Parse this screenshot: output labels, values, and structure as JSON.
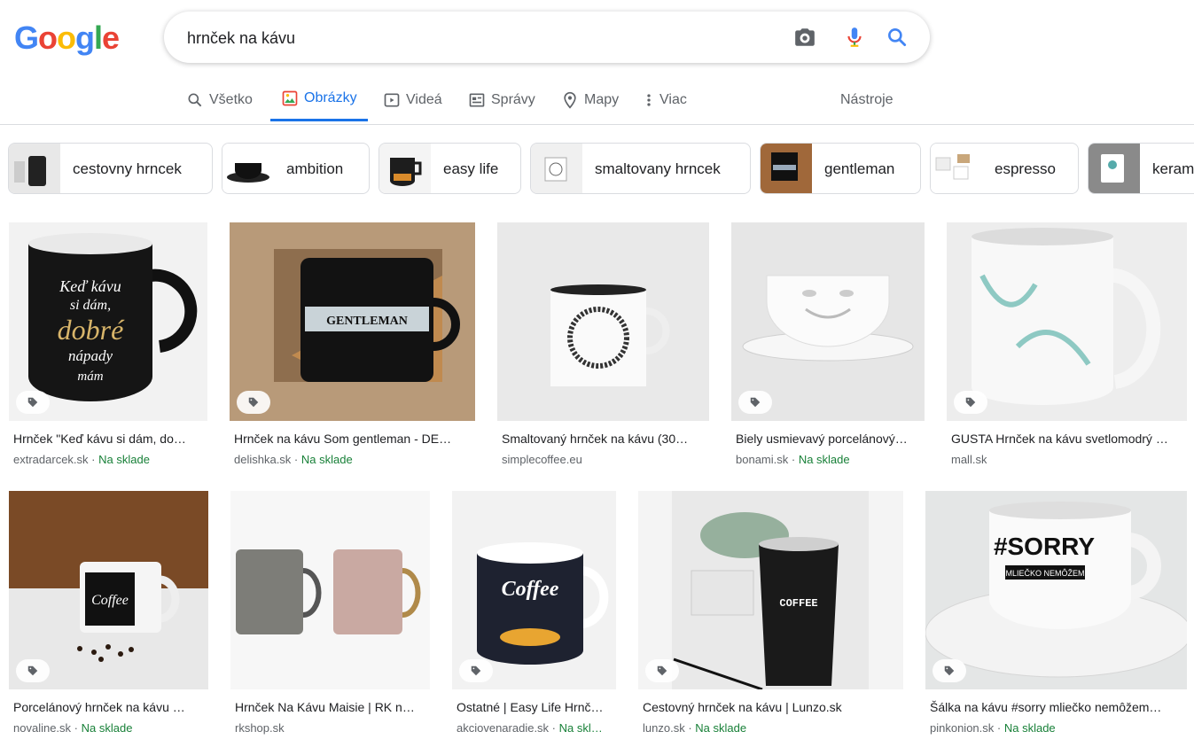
{
  "logo": {
    "letters": [
      "G",
      "o",
      "o",
      "g",
      "l",
      "e"
    ],
    "colors": [
      "#4285F4",
      "#EA4335",
      "#FBBC05",
      "#4285F4",
      "#34A853",
      "#EA4335"
    ]
  },
  "search": {
    "query": "hrnček na kávu",
    "placeholder": ""
  },
  "tabs": [
    {
      "label": "Všetko",
      "icon": "search-icon"
    },
    {
      "label": "Obrázky",
      "icon": "image-icon",
      "active": true
    },
    {
      "label": "Videá",
      "icon": "play-icon"
    },
    {
      "label": "Správy",
      "icon": "news-icon"
    },
    {
      "label": "Mapy",
      "icon": "map-pin-icon"
    },
    {
      "label": "Viac",
      "icon": "more-vertical-icon"
    }
  ],
  "tools_label": "Nástroje",
  "chips": [
    "cestovny hrncek",
    "ambition",
    "easy life",
    "smaltovany hrncek",
    "gentleman",
    "espresso",
    "keram"
  ],
  "results_row1": [
    {
      "title": "Hrnček \"Keď kávu si dám, do…",
      "source": "extradarcek.sk",
      "stock": "Na sklade"
    },
    {
      "title": "Hrnček na kávu Som gentleman - DE…",
      "source": "delishka.sk",
      "stock": "Na sklade"
    },
    {
      "title": "Smaltovaný hrnček na kávu (30…",
      "source": "simplecoffee.eu",
      "stock": ""
    },
    {
      "title": "Biely usmievavý porcelánový…",
      "source": "bonami.sk",
      "stock": "Na sklade"
    },
    {
      "title": "GUSTA Hrnček na kávu svetlomodrý …",
      "source": "mall.sk",
      "stock": ""
    }
  ],
  "results_row2": [
    {
      "title": "Porcelánový hrnček na kávu …",
      "source": "novaline.sk",
      "stock": "Na sklade"
    },
    {
      "title": "Hrnček Na Kávu Maisie | RK n…",
      "source": "rkshop.sk",
      "stock": ""
    },
    {
      "title": "Ostatné | Easy Life Hrnč…",
      "source": "akciovenaradie.sk",
      "stock": "Na skl…"
    },
    {
      "title": "Cestovný hrnček na kávu | Lunzo.sk",
      "source": "lunzo.sk",
      "stock": "Na sklade"
    },
    {
      "title": "Šálka na kávu #sorry mliečko nemôžem…",
      "source": "pinkonion.sk",
      "stock": "Na sklade"
    }
  ],
  "image_text": {
    "mug1": [
      "Keď kávu",
      "si dám,",
      "dobré",
      "nápady",
      "mám"
    ],
    "mug2": "GENTLEMAN",
    "mug6": "Coffee",
    "mug8": "Coffee",
    "mug9": "COFFEE",
    "mug10": "#SORRY",
    "mug10_sub": "MLIEČKO NEMÔŽEM"
  },
  "separator": " · "
}
